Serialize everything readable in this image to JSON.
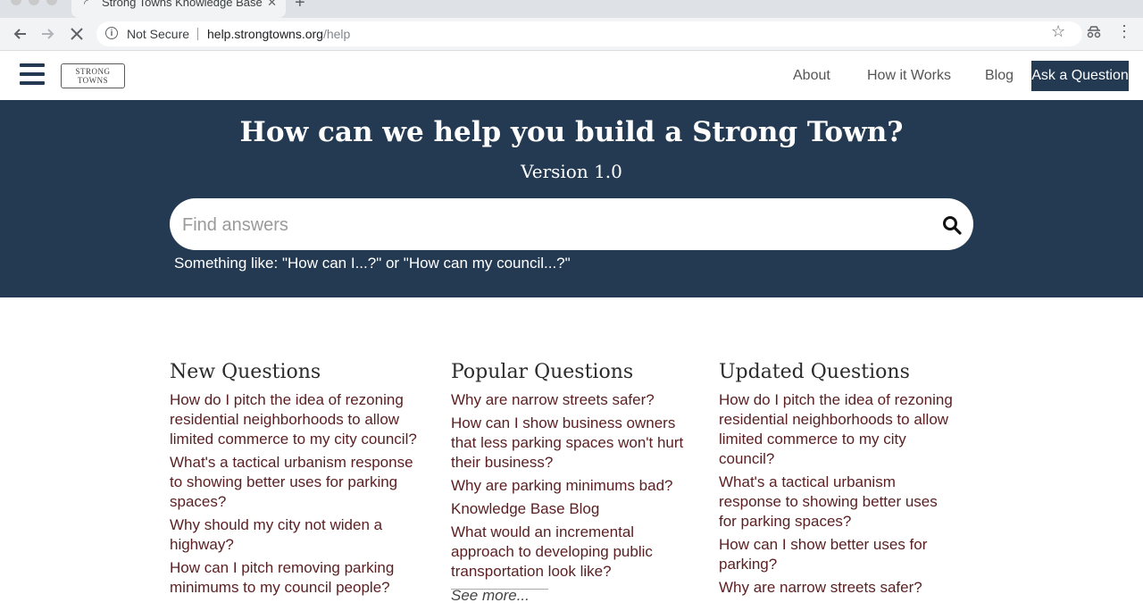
{
  "browser": {
    "tab_title": "Strong Towns Knowledge Base",
    "not_secure": "Not Secure",
    "url_host": "help.strongtowns.org",
    "url_path": "/help"
  },
  "header": {
    "nav": [
      "About",
      "How it Works",
      "Blog"
    ],
    "ask_button": "Ask a Question",
    "logo_line1": "STRONG",
    "logo_line2": "TOWNS"
  },
  "hero": {
    "title": "How can we help you build a Strong Town?",
    "version": "Version 1.0",
    "search_placeholder": "Find answers",
    "hint": "Something like: \"How can I...?\" or \"How can my council...?\""
  },
  "columns": {
    "new": {
      "title": "New Questions",
      "items": [
        "How do I pitch the idea of rezoning residential neighborhoods to allow limited commerce to my city council?",
        "What's a tactical urbanism response to showing better uses for parking spaces?",
        "Why should my city not widen a highway?",
        "How can I pitch removing parking minimums to my council people?"
      ]
    },
    "popular": {
      "title": "Popular Questions",
      "items": [
        "Why are narrow streets safer?",
        "How can I show business owners that less parking spaces won't hurt their business?",
        "Why are parking minimums bad?",
        "Knowledge Base Blog",
        "What would an incremental approach to developing public transportation look like?"
      ],
      "see_more": "See more..."
    },
    "updated": {
      "title": "Updated Questions",
      "items": [
        "How do I pitch the idea of rezoning residential neighborhoods to allow limited commerce to my city council?",
        "What's a tactical urbanism response to showing better uses for parking spaces?",
        "How can I show better uses for parking?",
        "Why are narrow streets safer?"
      ]
    }
  }
}
